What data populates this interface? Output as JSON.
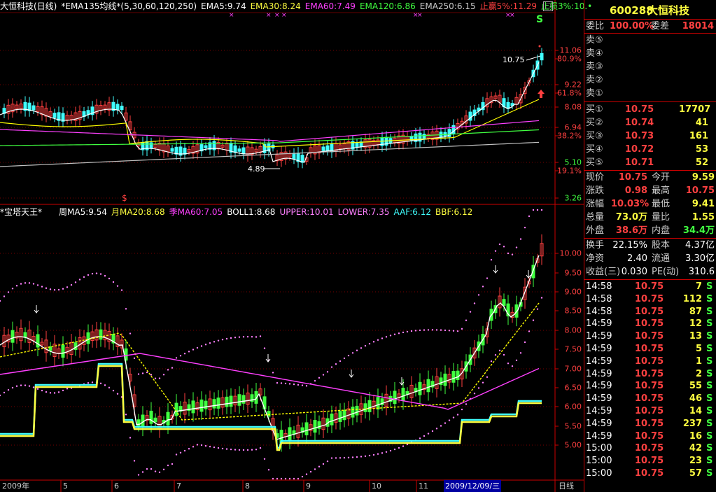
{
  "top_header": {
    "stock_name": "大恒科技(日线)",
    "indicator": "*EMA135均线*(5,30,60,120,250)",
    "ema5": "EMA5:9.74",
    "ema30": "EMA30:8.24",
    "ema60": "EMA60:7.49",
    "ema120": "EMA120:6.86",
    "ema250": "EMA250:6.15",
    "stop_profit": "止赢5%:11.29",
    "stop_loss": "止损3%:10.•"
  },
  "top_chart": {
    "s_mark": "S",
    "s_mark_bottom": "$",
    "annotation_high": "10.75",
    "annotation_low": "4.89",
    "y_labels": [
      "11.06",
      "80.9%",
      "9.22",
      "61.8%",
      "8.08",
      "6.94",
      "38.2%",
      "5.10",
      "19.1%",
      "3.26"
    ]
  },
  "bottom_header": {
    "name": "*宝塔天王*",
    "week_ma5": "周MA5:9.54",
    "month_ma20": "月MA20:8.68",
    "season_ma60": "季MA60:7.05",
    "boll": "BOLL1:8.68",
    "upper": "UPPER:10.01",
    "lower": "LOWER:7.35",
    "aaf": "AAF:6.12",
    "bbf": "BBF:6.12"
  },
  "bottom_chart": {
    "y_labels": [
      "10.00",
      "9.50",
      "9.00",
      "8.50",
      "8.00",
      "7.50",
      "7.00",
      "6.50",
      "6.00",
      "5.50",
      "5.00"
    ]
  },
  "date_axis": {
    "labels": [
      "2009年",
      "5",
      "6",
      "7",
      "8",
      "9",
      "10",
      "11"
    ],
    "highlight": "2009/12/09/三",
    "period": "日线"
  },
  "panel": {
    "code": "600288",
    "name": "大恒科技",
    "weibi_label": "委比",
    "weibi_value": "100.00%",
    "weicha_label": "委差",
    "weicha_value": "18014",
    "sells": [
      "卖⑤",
      "卖④",
      "卖③",
      "卖②",
      "卖①"
    ],
    "buys": [
      {
        "label": "买①",
        "price": "10.75",
        "vol": "17707"
      },
      {
        "label": "买②",
        "price": "10.74",
        "vol": "41"
      },
      {
        "label": "买③",
        "price": "10.73",
        "vol": "161"
      },
      {
        "label": "买④",
        "price": "10.72",
        "vol": "53"
      },
      {
        "label": "买⑤",
        "price": "10.71",
        "vol": "52"
      }
    ],
    "quote": [
      {
        "l1": "现价",
        "v1": "10.75",
        "c1": "red",
        "l2": "今开",
        "v2": "9.59",
        "c2": "yellow"
      },
      {
        "l1": "涨跌",
        "v1": "0.98",
        "c1": "red",
        "l2": "最高",
        "v2": "10.75",
        "c2": "red"
      },
      {
        "l1": "涨幅",
        "v1": "10.03%",
        "c1": "red",
        "l2": "最低",
        "v2": "9.41",
        "c2": "yellow"
      },
      {
        "l1": "总量",
        "v1": "73.0万",
        "c1": "yellow",
        "l2": "量比",
        "v2": "1.55",
        "c2": "yellow"
      },
      {
        "l1": "外盘",
        "v1": "38.6万",
        "c1": "red",
        "l2": "内盘",
        "v2": "34.4万",
        "c2": "green"
      }
    ],
    "fund": [
      {
        "l1": "换手",
        "v1": "22.15%",
        "l2": "股本",
        "v2": "4.37亿"
      },
      {
        "l1": "净资",
        "v1": "2.40",
        "l2": "流通",
        "v2": "3.30亿"
      },
      {
        "l1": "收益(三)",
        "v1": "0.030",
        "l2": "PE(动)",
        "v2": "310.6"
      }
    ],
    "ticks": [
      {
        "time": "14:58",
        "price": "10.75",
        "vol": "7",
        "flag": "S"
      },
      {
        "time": "14:58",
        "price": "10.75",
        "vol": "112",
        "flag": "S"
      },
      {
        "time": "14:58",
        "price": "10.75",
        "vol": "87",
        "flag": "S"
      },
      {
        "time": "14:59",
        "price": "10.75",
        "vol": "12",
        "flag": "S"
      },
      {
        "time": "14:59",
        "price": "10.75",
        "vol": "13",
        "flag": "S"
      },
      {
        "time": "14:59",
        "price": "10.75",
        "vol": "5",
        "flag": "S"
      },
      {
        "time": "14:59",
        "price": "10.75",
        "vol": "1",
        "flag": "S"
      },
      {
        "time": "14:59",
        "price": "10.75",
        "vol": "2",
        "flag": "S"
      },
      {
        "time": "14:59",
        "price": "10.75",
        "vol": "55",
        "flag": "S"
      },
      {
        "time": "14:59",
        "price": "10.75",
        "vol": "46",
        "flag": "S"
      },
      {
        "time": "14:59",
        "price": "10.75",
        "vol": "14",
        "flag": "S"
      },
      {
        "time": "14:59",
        "price": "10.75",
        "vol": "237",
        "flag": "S"
      },
      {
        "time": "14:59",
        "price": "10.75",
        "vol": "16",
        "flag": "S"
      },
      {
        "time": "15:00",
        "price": "10.75",
        "vol": "42",
        "flag": "S"
      },
      {
        "time": "15:00",
        "price": "10.75",
        "vol": "23",
        "flag": "S"
      },
      {
        "time": "15:00",
        "price": "10.75",
        "vol": "57",
        "flag": "S"
      }
    ]
  },
  "colors": {
    "up": "#ff4040",
    "down": "#40ffff",
    "ema5": "#ffffff",
    "ema30": "#ffff00",
    "ema60": "#ff40ff",
    "ema120": "#40ff40",
    "ema250": "#c0c0c0",
    "grid": "#a00000"
  }
}
